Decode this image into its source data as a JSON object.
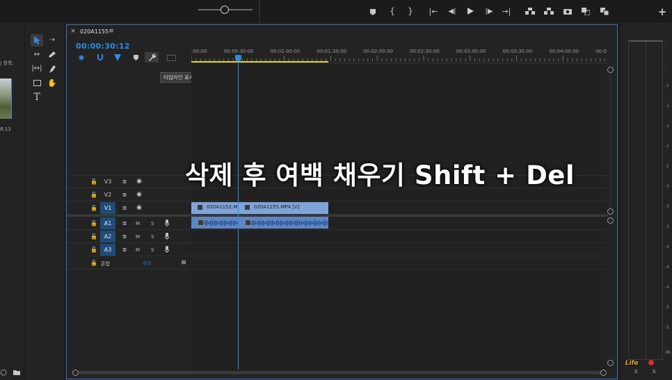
{
  "sequence": {
    "tab_name": "020A1155",
    "timecode": "00:00:30:12",
    "tooltip": "타임라인 표시 설정",
    "ruler_labels": [
      ":00:00",
      "00:00:30:00",
      "00:01:00:00",
      "00:01:30:00",
      "00:02:00:00",
      "00:02:30:00",
      "00:03:00:00",
      "00:03:30:00",
      "00:04:00:00",
      "00:0"
    ],
    "playhead_timecode": "00:00:30:12"
  },
  "tracks": {
    "video": [
      {
        "label": "V3"
      },
      {
        "label": "V2"
      },
      {
        "label": "V1"
      }
    ],
    "audio": [
      {
        "label": "A1",
        "m": "M",
        "s": "S"
      },
      {
        "label": "A2",
        "m": "M",
        "s": "S"
      },
      {
        "label": "A3",
        "m": "M",
        "s": "S"
      }
    ],
    "mix": {
      "label": "혼합",
      "value": "0.0"
    }
  },
  "clips": {
    "video1": "020A1152.M",
    "video2": "020A1155.MP4 [V]"
  },
  "left_panel": {
    "partial_text_1": "| 항목.",
    "partial_text_2": "8:13"
  },
  "overlay_caption": "삭제 후 여백 채우기 Shift + Del",
  "right_meter": {
    "ticks": [
      "-",
      "-",
      "-1",
      "-1",
      "-1",
      "-2",
      "-2",
      "-3",
      "-3",
      "-3",
      "-4",
      "-4",
      "-4",
      "-5",
      "-5",
      "-dB"
    ],
    "s_labels": [
      "S",
      "S"
    ]
  },
  "watermark": "Life",
  "colors": {
    "accent_blue": "#2d8ceb",
    "clip_video": "#7ea4d8",
    "clip_audio": "#5d86c4",
    "work_area": "#e7d12c",
    "panel_bg": "#232323",
    "outline": "#3b73c9"
  }
}
